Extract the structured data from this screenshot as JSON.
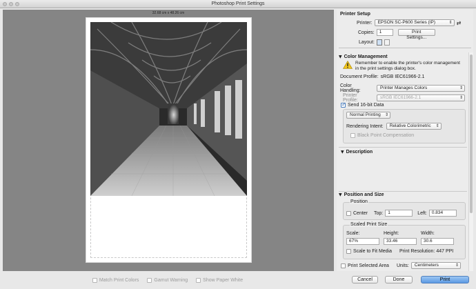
{
  "window": {
    "title": "Photoshop Print Settings"
  },
  "preview": {
    "paper_dimensions": "32.68 cm x 48.26 cm",
    "options": [
      {
        "label": "Match Print Colors",
        "checked": false
      },
      {
        "label": "Gamut Warning",
        "checked": false
      },
      {
        "label": "Show Paper White",
        "checked": false
      }
    ]
  },
  "printer_setup": {
    "title": "Printer Setup",
    "printer_label": "Printer:",
    "printer_value": "EPSON SC-P600 Series (IP)",
    "copies_label": "Copies:",
    "copies_value": "1",
    "print_settings_button": "Print Settings...",
    "layout_label": "Layout:"
  },
  "color_management": {
    "title": "Color Management",
    "warning": "Remember to enable the printer's color management in the print settings dialog box.",
    "document_profile_label": "Document Profile:",
    "document_profile_value": "sRGB IEC61966-2.1",
    "color_handling_label": "Color Handling:",
    "color_handling_value": "Printer Manages Colors",
    "printer_profile_label": "Printer Profile:",
    "printer_profile_value": "sRGB IEC61966-2.1",
    "send_16bit_label": "Send 16-bit Data",
    "send_16bit_checked": true,
    "proof_mode_value": "Normal Printing",
    "rendering_intent_label": "Rendering Intent:",
    "rendering_intent_value": "Relative Colorimetric",
    "black_point_label": "Black Point Compensation"
  },
  "description": {
    "title": "Description"
  },
  "position_size": {
    "title": "Position and Size",
    "position_title": "Position",
    "center_label": "Center",
    "top_label": "Top:",
    "top_value": "1",
    "left_label": "Left:",
    "left_value": "0.834",
    "scaled_title": "Scaled Print Size",
    "scale_label": "Scale:",
    "scale_value": "67%",
    "height_label": "Height:",
    "height_value": "33.46",
    "width_label": "Width:",
    "width_value": "30.6",
    "scale_to_fit_label": "Scale to Fit Media",
    "print_resolution": "Print Resolution: 447 PPI",
    "print_selected_label": "Print Selected Area",
    "units_label": "Units:",
    "units_value": "Centimeters"
  },
  "buttons": {
    "cancel": "Cancel",
    "done": "Done",
    "print": "Print"
  },
  "colors": {
    "preview_bg": "#858585",
    "panel_bg": "#ececec",
    "primary": "#5c9ae3"
  }
}
